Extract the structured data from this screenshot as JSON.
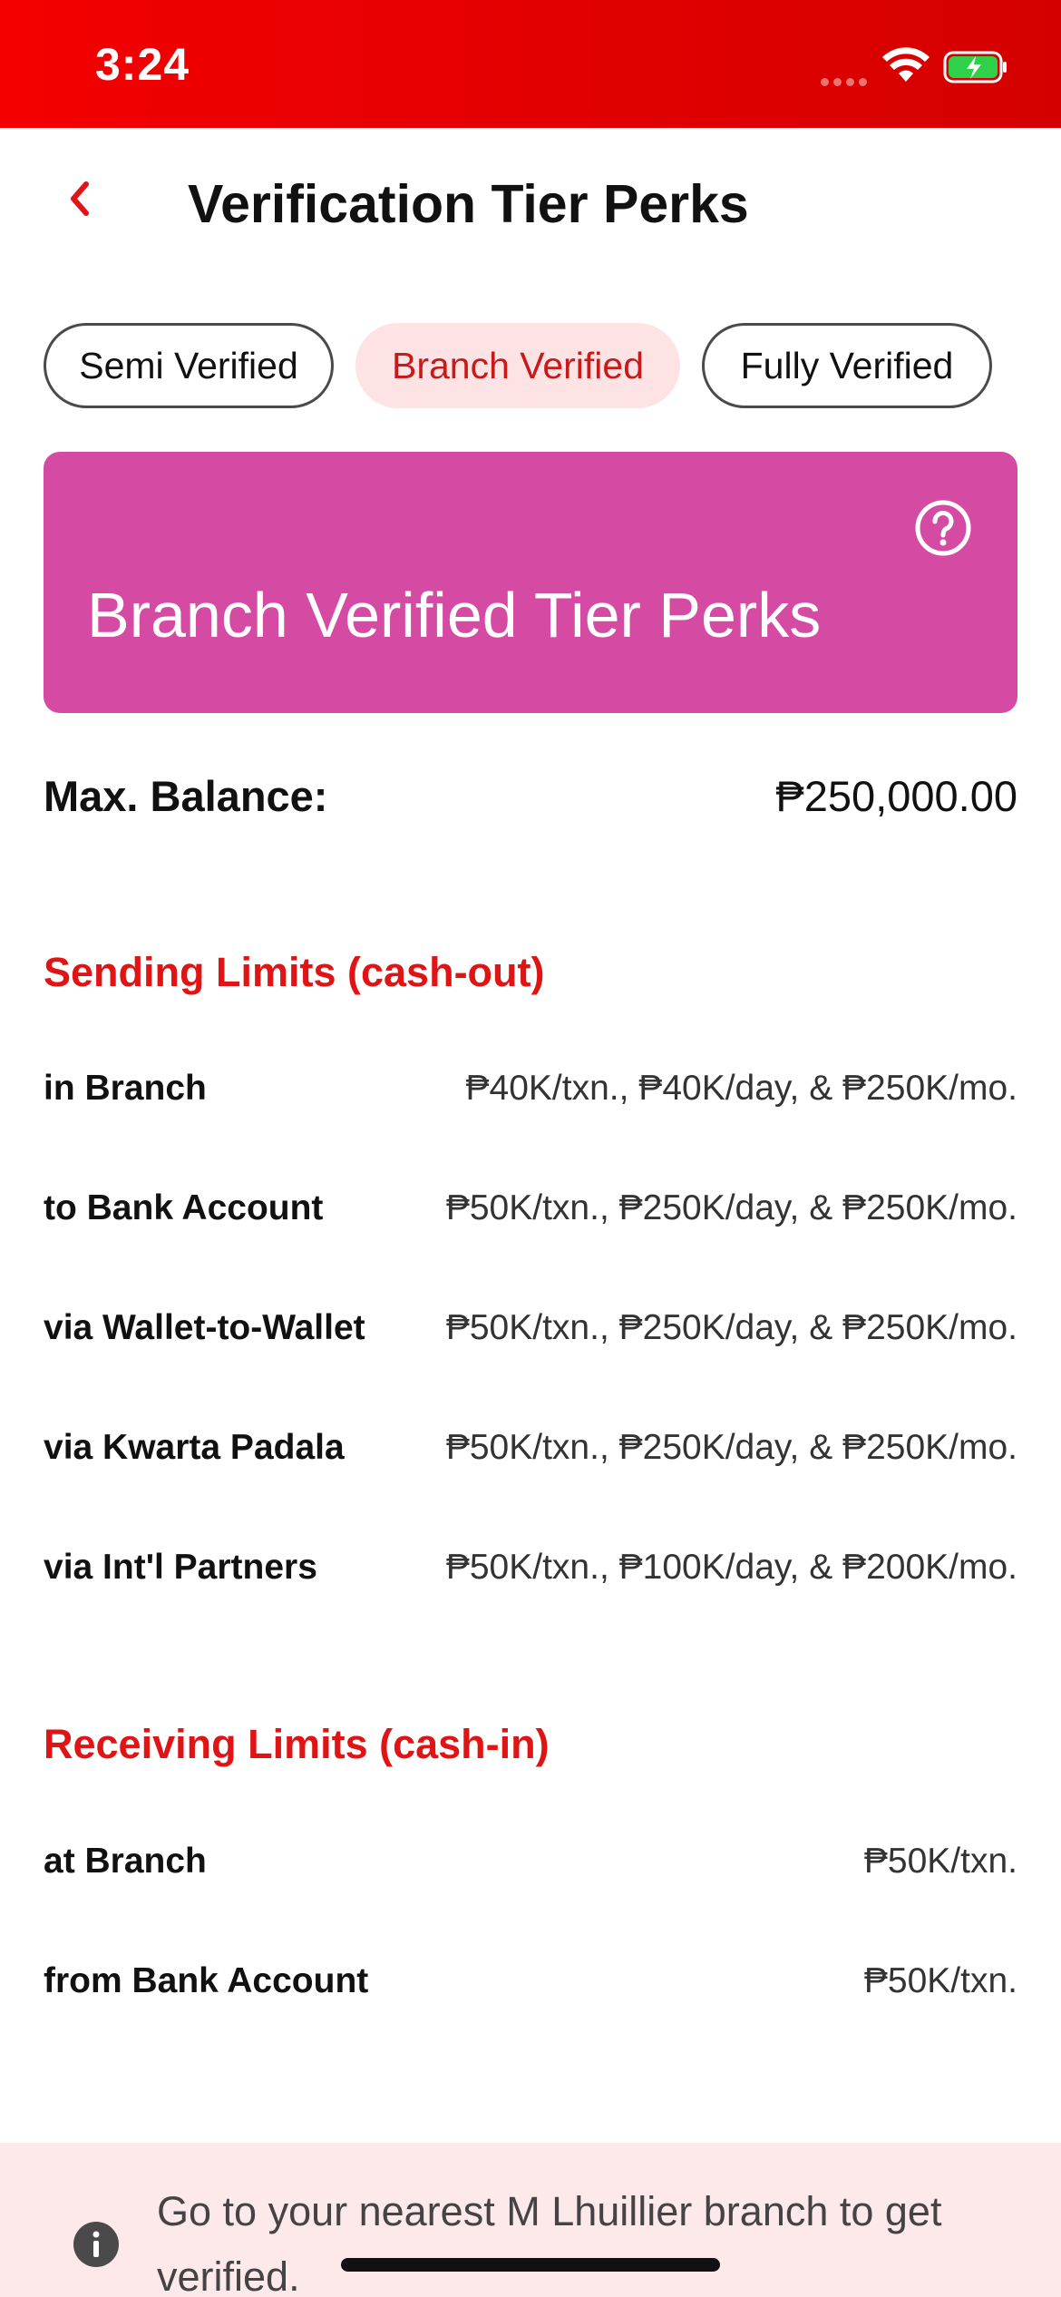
{
  "status_bar": {
    "time": "3:24"
  },
  "header": {
    "title": "Verification Tier Perks"
  },
  "tabs": [
    {
      "label": "Semi Verified"
    },
    {
      "label": "Branch Verified"
    },
    {
      "label": "Fully Verified"
    }
  ],
  "selected_tab": "Branch Verified",
  "banner": {
    "title": "Branch Verified Tier Perks",
    "color": "#d54ba3"
  },
  "max_balance": {
    "label": "Max. Balance:",
    "value": "₱250,000.00"
  },
  "sending": {
    "title": "Sending Limits (cash-out)",
    "rows": [
      {
        "label": "in Branch",
        "value": "₱40K/txn., ₱40K/day, & ₱250K/mo."
      },
      {
        "label": "to Bank Account",
        "value": "₱50K/txn., ₱250K/day, & ₱250K/mo."
      },
      {
        "label": "via Wallet-to-Wallet",
        "value": "₱50K/txn., ₱250K/day, & ₱250K/mo."
      },
      {
        "label": "via Kwarta Padala",
        "value": "₱50K/txn., ₱250K/day, & ₱250K/mo."
      },
      {
        "label": "via Int'l Partners",
        "value": "₱50K/txn., ₱100K/day, & ₱200K/mo."
      }
    ]
  },
  "receiving": {
    "title": "Receiving Limits (cash-in)",
    "rows": [
      {
        "label": "at Branch",
        "value": "₱50K/txn."
      },
      {
        "label": "from Bank Account",
        "value": "₱50K/txn."
      }
    ]
  },
  "notice": {
    "text": "Go to your nearest M Lhuillier branch to get verified."
  },
  "icons": {
    "back": "chevron-left-icon",
    "help": "question-circle-icon",
    "info": "info-icon",
    "wifi": "wifi-icon",
    "battery": "battery-charging-icon"
  },
  "colors": {
    "status_bar": "#e00000",
    "accent": "#e01414",
    "selected_tab_bg": "#fde3e3",
    "notice_bg": "#fde8ea"
  }
}
